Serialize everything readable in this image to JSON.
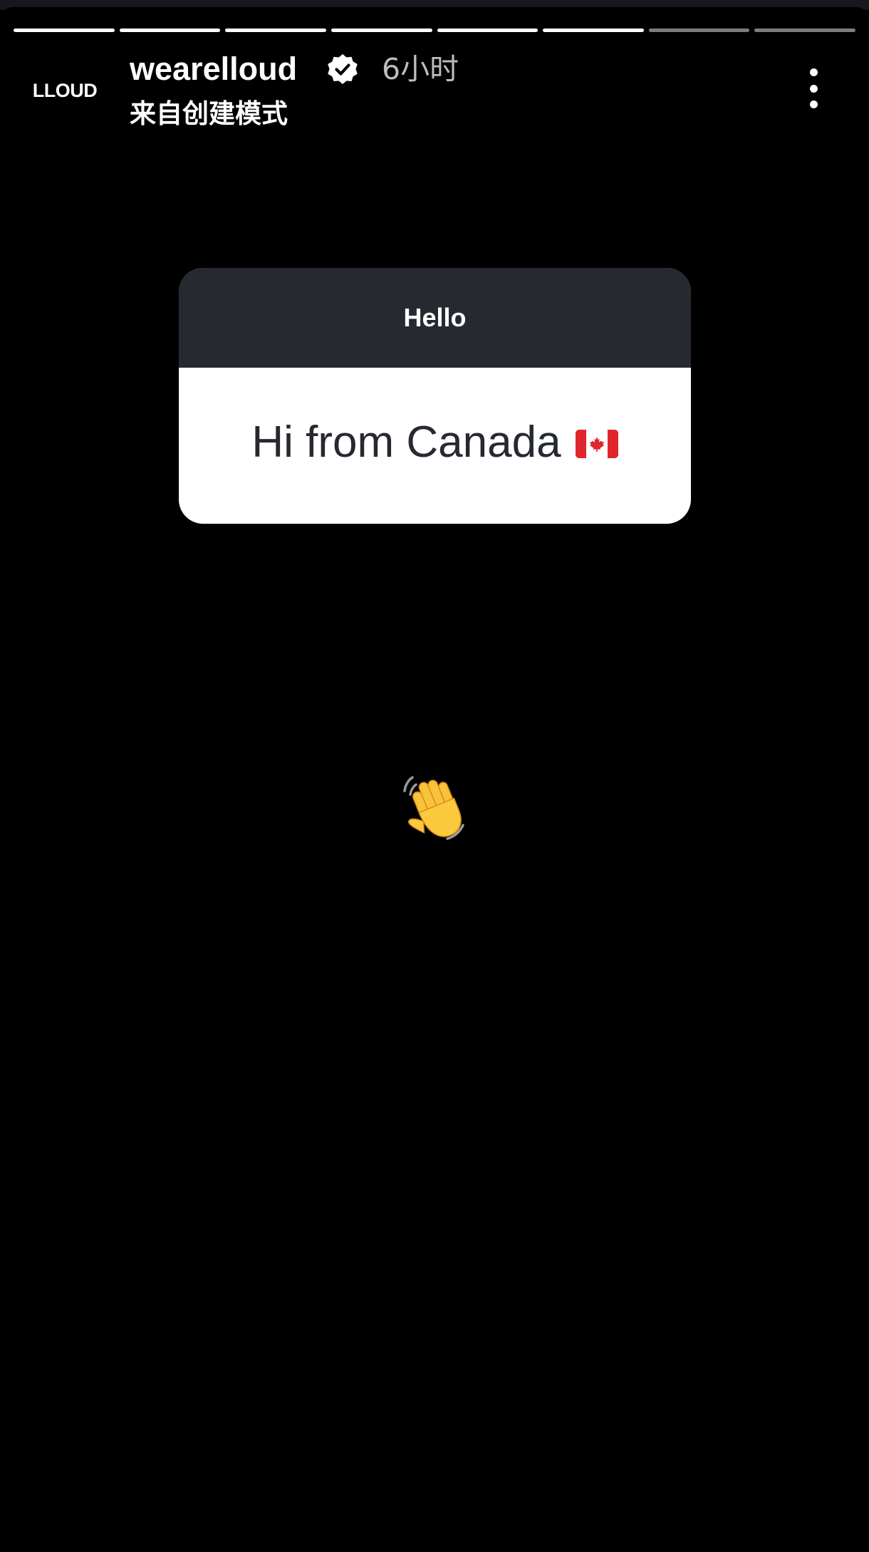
{
  "story": {
    "progress_total": 8,
    "progress_viewed": 6,
    "account": {
      "avatar_text": "LLOUD",
      "username": "wearelloud",
      "verified": true,
      "time_ago": "6小时",
      "subtitle": "来自创建模式"
    },
    "menu_icon": "more-vertical-icon",
    "question_card": {
      "prompt": "Hello",
      "answer": "Hi from Canada",
      "answer_icon": "canada-flag-icon"
    },
    "sticker_icon": "waving-hand-icon"
  },
  "colors": {
    "background": "#000000",
    "card_header": "#262930",
    "card_body": "#ffffff",
    "answer_text": "#262930",
    "time_text": "#bdbdbd",
    "progress_viewed": "#ffffff",
    "progress_pending": "#7c7d80"
  }
}
